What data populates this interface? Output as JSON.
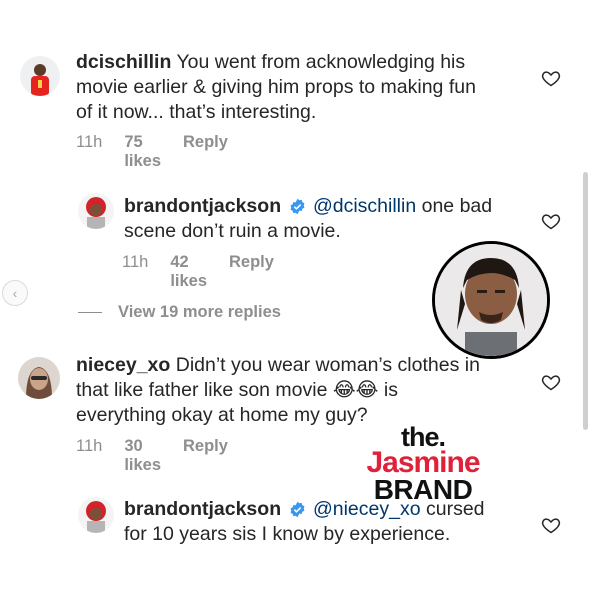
{
  "comments": [
    {
      "username": "dcischillin",
      "text_lines": [
        "You went from acknowledging his",
        "movie earlier & giving him props to making fun",
        "of it now... that’s interesting."
      ],
      "time": "11h",
      "likes": "75 likes",
      "reply": "Reply"
    },
    {
      "username": "brandontjackson",
      "mention": "@dcischillin",
      "text_first": " one bad",
      "text_second": "scene don’t ruin a movie.",
      "time": "11h",
      "likes": "42 likes",
      "reply": "Reply"
    },
    {
      "username": "niecey_xo",
      "text_line1": "Didn’t you wear woman’s clothes in",
      "text_line2_a": "that like father like son movie ",
      "emojis": "😂😂",
      "text_line2_b": " is",
      "text_line3": "everything okay at home my guy?",
      "time": "11h",
      "likes": "30 likes",
      "reply": "Reply"
    },
    {
      "username": "brandontjackson",
      "mention": "@niecey_xo",
      "text_first": " cursed",
      "text_second": "for 10 years sis I know by experience.",
      "time": "",
      "likes": "",
      "reply": ""
    }
  ],
  "view_replies": "View 19 more replies",
  "watermark": {
    "the": "the.",
    "jasmine": "Jasmine",
    "brand": "BRAND"
  },
  "colors": {
    "mention": "#00376b",
    "meta": "#8e8e8e",
    "verified": "#3897f0",
    "brand_red": "#e0213a"
  }
}
